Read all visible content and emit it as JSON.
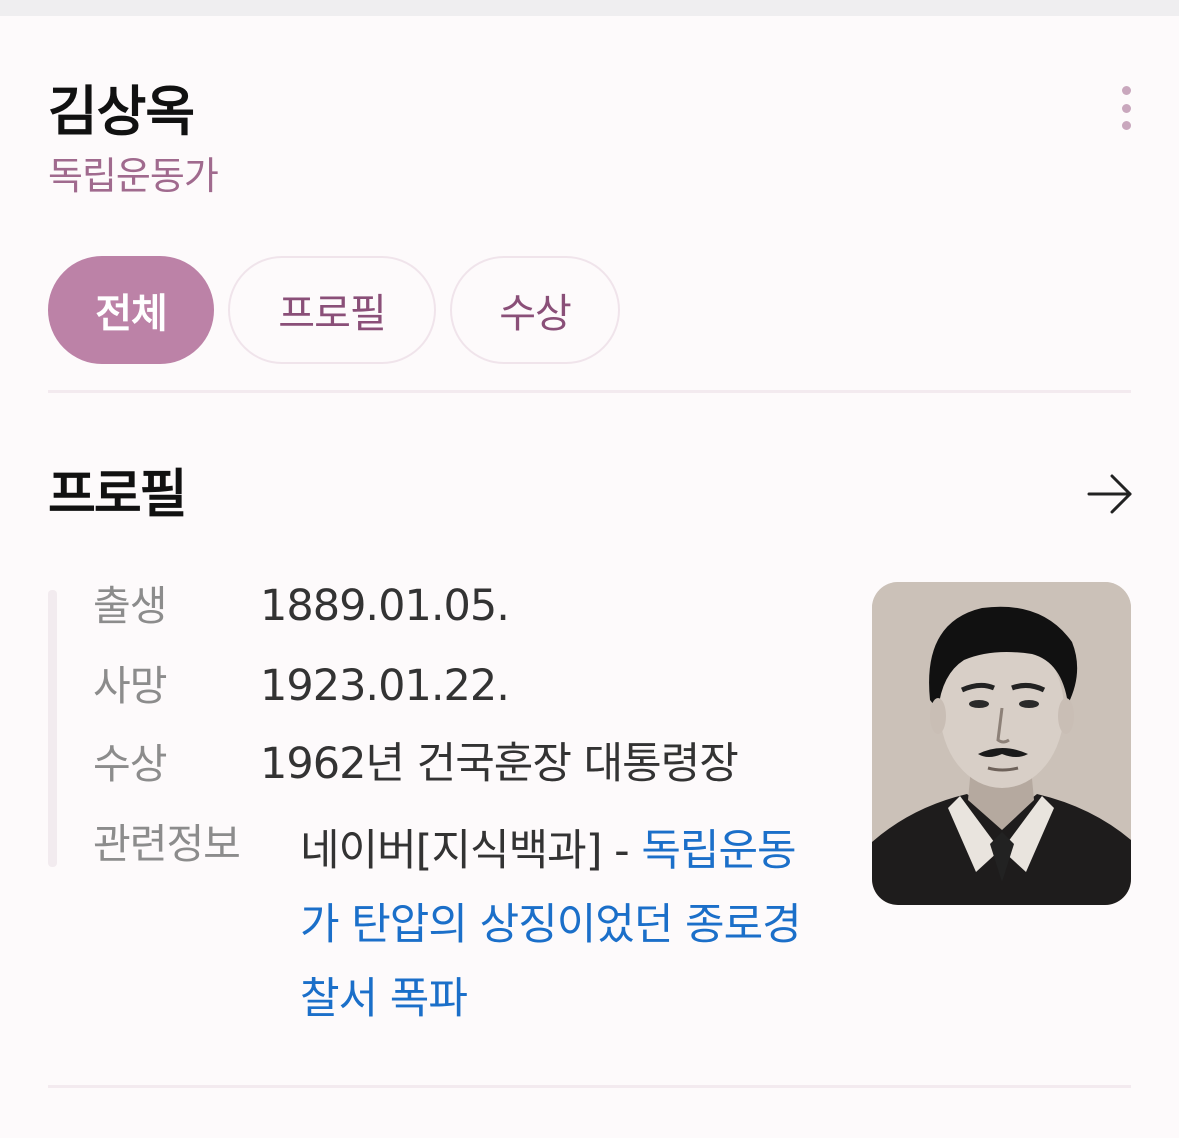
{
  "header": {
    "title": "김상옥",
    "subtitle": "독립운동가"
  },
  "tabs": [
    {
      "label": "전체",
      "active": true
    },
    {
      "label": "프로필",
      "active": false
    },
    {
      "label": "수상",
      "active": false
    }
  ],
  "profile": {
    "section_title": "프로필",
    "rows": [
      {
        "label": "출생",
        "value": "1889.01.05."
      },
      {
        "label": "사망",
        "value": "1923.01.22."
      },
      {
        "label": "수상",
        "value": "1962년 건국훈장 대통령장"
      }
    ],
    "related": {
      "label": "관련정보",
      "prefix": "네이버[지식백과] - ",
      "link_text": "독립운동가 탄압의 상징이었던 종로경찰서 폭파"
    }
  },
  "colors": {
    "accent": "#bc82a7",
    "subtitle": "#a06a8e",
    "link": "#1b6fc9"
  },
  "icons": {
    "more": "more-vertical-icon",
    "arrow": "arrow-right-icon"
  }
}
